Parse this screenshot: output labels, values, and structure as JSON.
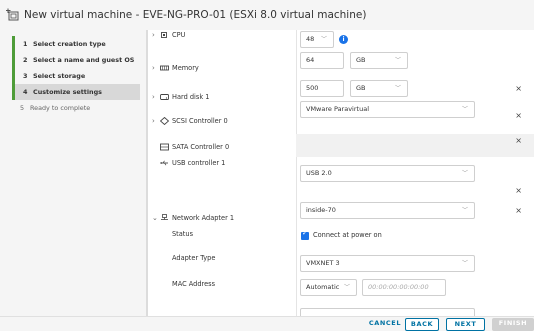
{
  "window": {
    "title": "New virtual machine - EVE-NG-PRO-01 (ESXi 8.0 virtual machine)"
  },
  "steps": [
    {
      "num": "1",
      "label": "Select creation type",
      "state": "done"
    },
    {
      "num": "2",
      "label": "Select a name and guest OS",
      "state": "done"
    },
    {
      "num": "3",
      "label": "Select storage",
      "state": "done"
    },
    {
      "num": "4",
      "label": "Customize settings",
      "state": "active"
    },
    {
      "num": "5",
      "label": "Ready to complete",
      "state": "pending"
    }
  ],
  "hardware": {
    "cpu": {
      "label": "CPU",
      "value": "48"
    },
    "memory": {
      "label": "Memory",
      "value": "64",
      "unit": "GB"
    },
    "hard_disk": {
      "label": "Hard disk 1",
      "value": "500",
      "unit": "GB"
    },
    "scsi": {
      "label": "SCSI Controller 0",
      "value": "VMware Paravirtual"
    },
    "sata": {
      "label": "SATA Controller 0"
    },
    "usb": {
      "label": "USB controller 1",
      "value": "USB 2.0"
    },
    "network": {
      "label": "Network Adapter 1",
      "value": "inside-70",
      "status_label": "Status",
      "status_value": "Connect at power on",
      "adapter_type_label": "Adapter Type",
      "adapter_type_value": "VMXNET 3",
      "mac_label": "MAC Address",
      "mac_mode": "Automatic",
      "mac_placeholder": "00:00:00:00:00:00"
    }
  },
  "footer": {
    "cancel": "CANCEL",
    "back": "BACK",
    "next": "NEXT",
    "finish": "FINISH"
  },
  "colors": {
    "accent": "#0072a3",
    "step_bar": "#4e9c38",
    "info": "#1a73e8"
  },
  "icons": {
    "close": "×",
    "chevron_right": "›",
    "chevron_down": "⌄",
    "caret": "﹀"
  }
}
